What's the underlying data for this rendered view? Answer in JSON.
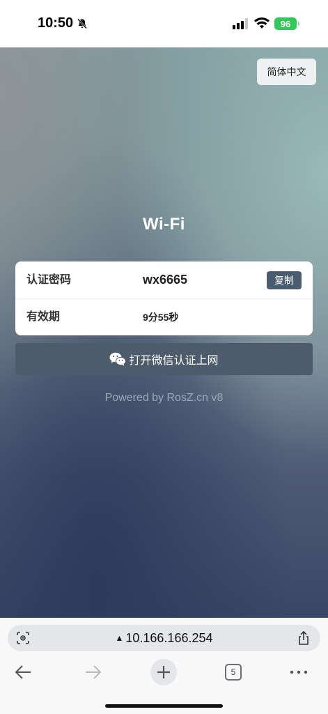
{
  "status_bar": {
    "time": "10:50",
    "battery": "96",
    "icons": [
      "bell-slash-icon",
      "signal-icon",
      "wifi-icon",
      "battery-icon"
    ]
  },
  "page": {
    "language_button": "简体中文",
    "title": "Wi-Fi",
    "password_row": {
      "label": "认证密码",
      "value": "wx6665",
      "copy_label": "复制"
    },
    "validity_row": {
      "label": "有效期",
      "value": "9分55秒"
    },
    "wechat_button": "打开微信认证上网",
    "powered_by": "Powered by RosZ.cn v8",
    "colors": {
      "button_bg": "#4d5b6b",
      "copy_bg": "#4a5d70"
    }
  },
  "browser": {
    "url": "10.166.166.254",
    "warning_glyph": "▲",
    "tab_count": "5"
  }
}
